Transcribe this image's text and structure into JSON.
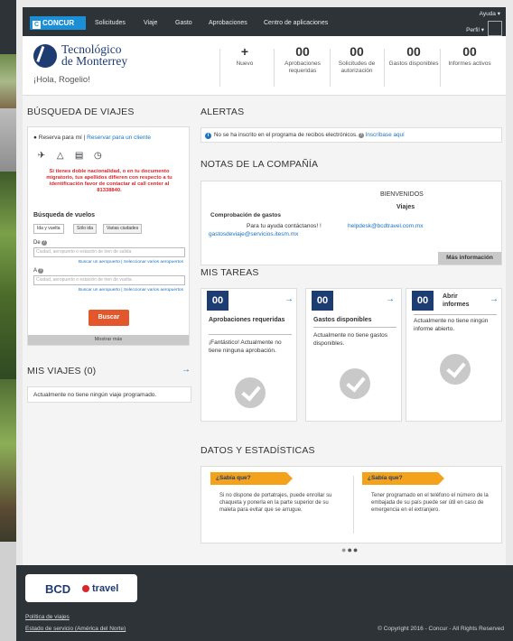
{
  "nav": {
    "logo_text": "CONCUR",
    "items": [
      "Solicitudes",
      "Viaje",
      "Gasto",
      "Aprobaciones",
      "Centro de aplicaciones"
    ],
    "help": "Ayuda ▾",
    "profile": "Perfil ▾"
  },
  "header": {
    "org_line1": "Tecnológico",
    "org_line2": "de Monterrey",
    "greeting": "¡Hola, Rogelio!",
    "new_icon": "+",
    "new_label": "Nuevo",
    "stats": [
      {
        "num": "00",
        "label": "Aprobaciones requeridas"
      },
      {
        "num": "00",
        "label": "Solicitudes de autorización"
      },
      {
        "num": "00",
        "label": "Gastos disponibles"
      },
      {
        "num": "00",
        "label": "Informes activos"
      }
    ]
  },
  "search": {
    "title": "BÚSQUEDA DE VIAJES",
    "reserve_me": "Reserva para mí",
    "sep": "|",
    "reserve_client": "Reservar para un cliente",
    "icons": [
      "airplane-icon",
      "car-icon",
      "hotel-icon",
      "clock-icon"
    ],
    "warning": "Si tienes doble nacionalidad, o en tu documento migratorio, tus apellidos difieren con respecto a tu identificación favor de contactar al call center al 81338840.",
    "flight_title": "Búsqueda de vuelos",
    "trip_types": [
      "Ida y vuelta",
      "Sólo ida",
      "Varias ciudades"
    ],
    "from_label": "De",
    "to_label": "A",
    "from_placeholder": "Ciudad, aeropuerto o estación de tren de salida",
    "to_placeholder": "Ciudad, aeropuerto o estación de tren de vuelta",
    "airport_links": "Buscar un aeropuerto  |  Seleccionar varios aeropuertos",
    "search_button": "Buscar",
    "show_more": "Mostrar más"
  },
  "trips": {
    "title": "MIS VIAJES (0)",
    "empty": "Actualmente no tiene ningún viaje programado."
  },
  "alerts": {
    "title": "ALERTAS",
    "text": "No se ha inscrito en el programa de recibos electrónicos.",
    "link": "Inscríbase aquí"
  },
  "notes": {
    "title": "NOTAS DE LA COMPAÑÍA",
    "welcome": "BIENVENIDOS",
    "viajes": "Viajes",
    "comprobacion": "Comprobación de gastos",
    "ayuda": "Para tu ayuda contáctanos! !",
    "email1": "helpdesk@bcdtravel.com.mx",
    "email2": "gastosdeviaje@servicios.itesm.mx",
    "more_info": "Más información"
  },
  "tasks": {
    "title": "MIS TAREAS",
    "cards": [
      {
        "num": "00",
        "title": "Aprobaciones requeridas",
        "text": "¡Fantástico! Actualmente no tiene ninguna aprobación."
      },
      {
        "num": "00",
        "title": "Gastos disponibles",
        "text": "Actualmente no tiene gastos disponibles."
      },
      {
        "num": "00",
        "title": "Abrir informes",
        "text": "Actualmente no tiene ningún informe abierto."
      }
    ]
  },
  "stats": {
    "title": "DATOS Y ESTADÍSTICAS",
    "tips": [
      {
        "ribbon": "¿Sabía que?",
        "text": "Si no dispone de portatrajes, puede enrollar su chaqueta y ponerla en la parte superior de su maleta para evitar que se arrugue."
      },
      {
        "ribbon": "¿Sabía que?",
        "text": "Tener programado en el teléfono el número de la embajada de su país puede ser útil en caso de emergencia en el extranjero."
      }
    ]
  },
  "footer": {
    "brand1": "BCD",
    "brand2": "travel",
    "link1": "Política de viajes",
    "link2": "Estado de servicio (América del Norte)",
    "copyright": "© Copyright 2016 - Concur - All Rights Reserved"
  },
  "colors": {
    "nav_bg": "#2e3338",
    "accent_blue": "#1a74c0",
    "badge_blue": "#1d3c72",
    "search_button": "#e2572c",
    "warning_red": "#d9262c",
    "ribbon_yellow": "#f4a11c"
  }
}
